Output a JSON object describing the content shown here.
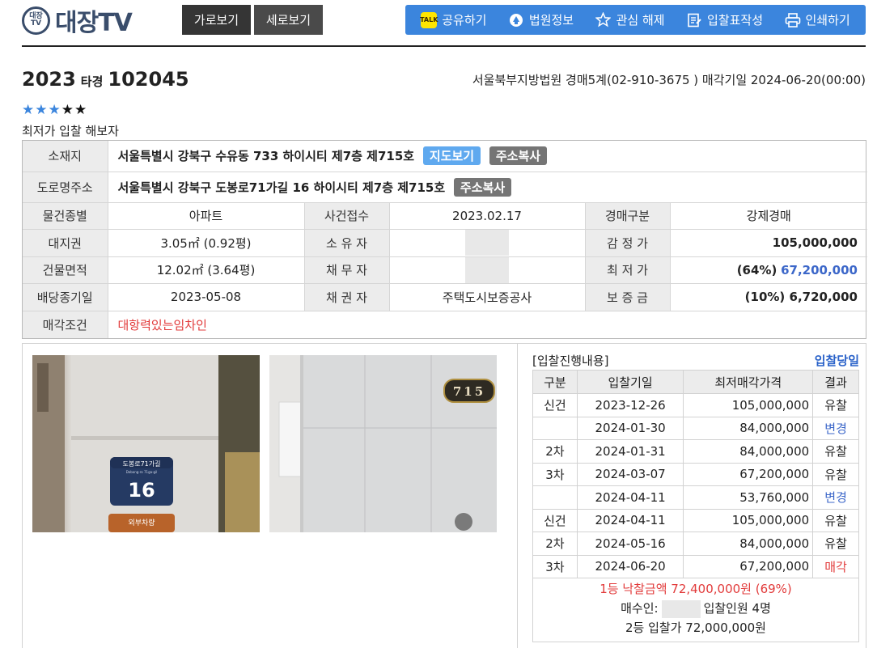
{
  "header": {
    "logo_badge": "대장TV",
    "logo_text": "대장TV",
    "view_horizontal": "가로보기",
    "view_vertical": "세로보기",
    "tools": [
      {
        "label": "공유하기",
        "icon": "kakaotalk-icon",
        "icon_text": "TALK"
      },
      {
        "label": "법원정보",
        "icon": "court-icon"
      },
      {
        "label": "관심 해제",
        "icon": "star-icon"
      },
      {
        "label": "입찰표작성",
        "icon": "form-icon"
      },
      {
        "label": "인쇄하기",
        "icon": "print-icon"
      }
    ],
    "accent_color": "#3b85dd"
  },
  "case": {
    "year": "2023",
    "type": "타경",
    "number": "102045",
    "court_info": "서울북부지방법원 경매5계(02-910-3675 ) 매각기일 2024-06-20(00:00)",
    "rating_filled": 3,
    "rating_total": 5,
    "memo": "최저가 입찰 해보자"
  },
  "info": {
    "address_label": "소재지",
    "address": "서울특별시 강북구 수유동 733 하이시티 제7층 제715호",
    "map_button": "지도보기",
    "copy_button": "주소복사",
    "road_label": "도로명주소",
    "road_address": "서울특별시 강북구 도봉로71가길 16 하이시티 제7층 제715호",
    "rows": [
      {
        "l1": "물건종별",
        "v1": "아파트",
        "l2": "사건접수",
        "v2": "2023.02.17",
        "l3": "경매구분",
        "v3": "강제경매"
      },
      {
        "l1": "대지권",
        "v1": "3.05㎡ (0.92평)",
        "l2": "소 유 자",
        "v2": "",
        "l3": "감 정 가",
        "v3": "105,000,000"
      },
      {
        "l1": "건물면적",
        "v1": "12.02㎡ (3.64평)",
        "l2": "채 무 자",
        "v2": "",
        "l3": "최 저 가",
        "v3_pct": "(64%)",
        "v3": "67,200,000"
      },
      {
        "l1": "배당종기일",
        "v1": "2023-05-08",
        "l2": "채 권 자",
        "v2": "주택도시보증공사",
        "l3": "보 증 금",
        "v3_pct": "(10%)",
        "v3": "6,720,000"
      }
    ],
    "condition_label": "매각조건",
    "condition": "대항력있는임차인"
  },
  "photos": {
    "sign_road": "도봉로71가길",
    "sign_road_en": "Dobong-ro 71ga-gil",
    "sign_number": "16",
    "sign_extra": "외부차량",
    "door_number": "715"
  },
  "bidding": {
    "title": "[입찰진행내용]",
    "status": "입찰당일",
    "columns": [
      "구분",
      "입찰기일",
      "최저매각가격",
      "결과"
    ],
    "rows": [
      {
        "round": "신건",
        "date": "2023-12-26",
        "price": "105,000,000",
        "result": "유찰",
        "kind": "normal"
      },
      {
        "round": "",
        "date": "2024-01-30",
        "price": "84,000,000",
        "result": "변경",
        "kind": "change"
      },
      {
        "round": "2차",
        "date": "2024-01-31",
        "price": "84,000,000",
        "result": "유찰",
        "kind": "normal"
      },
      {
        "round": "3차",
        "date": "2024-03-07",
        "price": "67,200,000",
        "result": "유찰",
        "kind": "normal"
      },
      {
        "round": "",
        "date": "2024-04-11",
        "price": "53,760,000",
        "result": "변경",
        "kind": "change"
      },
      {
        "round": "신건",
        "date": "2024-04-11",
        "price": "105,000,000",
        "result": "유찰",
        "kind": "normal"
      },
      {
        "round": "2차",
        "date": "2024-05-16",
        "price": "84,000,000",
        "result": "유찰",
        "kind": "normal"
      },
      {
        "round": "3차",
        "date": "2024-06-20",
        "price": "67,200,000",
        "result": "매각",
        "kind": "sold"
      }
    ],
    "winning": "1등 낙찰금액 72,400,000원 (69%)",
    "buyer_label": "매수인:",
    "bidders": "입찰인원 4명",
    "second": "2등 입찰가 72,000,000원"
  }
}
